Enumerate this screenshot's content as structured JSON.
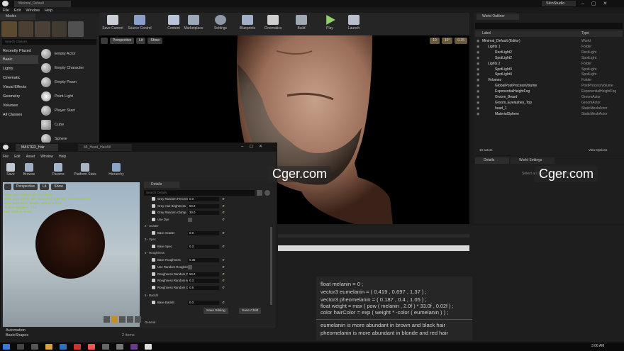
{
  "main_window": {
    "tab": "Minimal_Default",
    "menu": [
      "File",
      "Edit",
      "Window",
      "Help"
    ],
    "app_badge": "SkinStudio"
  },
  "toolbar": [
    "Save Current",
    "Source Control",
    "Content",
    "Marketplace",
    "Settings",
    "Blueprints",
    "Cinematics",
    "Build",
    "Play",
    "Launch"
  ],
  "modes": {
    "tab": "Modes",
    "search_placeholder": "Search Classes",
    "categories": [
      "Recently Placed",
      "Basic",
      "Lights",
      "Cinematic",
      "Visual Effects",
      "Geometry",
      "Volumes",
      "All Classes"
    ],
    "actors": [
      "Empty Actor",
      "Empty Character",
      "Empty Pawn",
      "Point Light",
      "Player Start",
      "Cube",
      "Sphere"
    ]
  },
  "viewport": {
    "buttons": [
      "Perspective",
      "Lit",
      "Show"
    ],
    "snap_values": [
      "10",
      "10°",
      "0.25"
    ]
  },
  "outliner": {
    "tab": "World Outliner",
    "col_label": "Label",
    "col_type": "Type",
    "rows": [
      {
        "name": "Minimal_Default (Editor)",
        "type": "World"
      },
      {
        "name": "Lights 1",
        "type": "Folder"
      },
      {
        "name": "RectLight2",
        "type": "RectLight"
      },
      {
        "name": "SpotLight2",
        "type": "SpotLight"
      },
      {
        "name": "Lights 2",
        "type": "Folder"
      },
      {
        "name": "SpotLight3",
        "type": "SpotLight"
      },
      {
        "name": "SpotLight4",
        "type": "SpotLight"
      },
      {
        "name": "Volumes",
        "type": "Folder"
      },
      {
        "name": "GlobalPostProcessVolume",
        "type": "PostProcessVolume"
      },
      {
        "name": "ExponentialHeightFog",
        "type": "ExponentialHeightFog"
      },
      {
        "name": "Groom_Beard",
        "type": "GroomActor"
      },
      {
        "name": "Groom_Eyelashes_Top",
        "type": "GroomActor"
      },
      {
        "name": "head_1",
        "type": "StaticMeshActor"
      },
      {
        "name": "MaterialSphere",
        "type": "StaticMeshActor"
      }
    ],
    "footer_count": "10 actors",
    "view_options": "View Options"
  },
  "right_tabs": [
    "Details",
    "World Settings"
  ],
  "right_hint": "Select an object to view details.",
  "material_window": {
    "tab1": "MASTER_Hair",
    "tab2": "MI_Head_HairAll",
    "menu": [
      "File",
      "Edit",
      "Asset",
      "Window",
      "Help"
    ],
    "toolbar": [
      "Save",
      "Browse",
      "Params",
      "Platform Stats",
      "Hierarchy"
    ],
    "view_buttons": [
      "Perspective",
      "Lit",
      "Show"
    ],
    "warnings": [
      "Base pass shader: 99 instructions",
      "Base pass shader with Volumetric Lightmap: 101 instructions",
      "Base pass vertex shader: 48 instructions",
      "Texture samplers: 3/16",
      "Hair shaders Model"
    ],
    "details_tab": "Details",
    "details_search": "Search Details",
    "props": [
      {
        "label": "Grey Random Percent",
        "value": "0.0",
        "checked": true
      },
      {
        "label": "Grey Hair Brightness",
        "value": "50.0",
        "checked": true
      },
      {
        "label": "Grey Random Clamp",
        "value": "30.0",
        "checked": true
      },
      {
        "label": "Use Dye",
        "value": "",
        "checked": true
      }
    ],
    "sections": [
      "2 - Scatter",
      "3 - Spec",
      "4 - Roughness",
      "5 - Backlit",
      "General"
    ],
    "scatter": [
      {
        "label": "Base Scatter",
        "value": "0.0"
      }
    ],
    "spec": [
      {
        "label": "Base Spec",
        "value": "0.3"
      }
    ],
    "rough": [
      {
        "label": "Base Roughness",
        "value": "0.35"
      },
      {
        "label": "Use Random Roughness",
        "value": ""
      },
      {
        "label": "Roughness Random Percent",
        "value": "50.0"
      },
      {
        "label": "Roughness Random Min",
        "value": "0.3"
      },
      {
        "label": "Roughness Random Clamp",
        "value": "0.5"
      }
    ],
    "backlit": [
      {
        "label": "Base Backlit",
        "value": "0.0"
      }
    ],
    "save_sibling": "Save Sibling",
    "save_child": "Save Child"
  },
  "code_lines": [
    "float melanin = 0 ;",
    "vector3 eumelanin = ( 0.419 , 0.697 , 1.37 ) ;",
    "vector3 pheomelanin = ( 0.187 , 0.4 , 1.05 ) ;",
    "float weight = max ( pow ( melanin , 2.0f ) * 33.0f , 0.02f ) ;",
    "color hairColor = exp ( weight * -color ( eumelanin ) ) ;"
  ],
  "notes": [
    "eumelanin is more abundant in brown and black hair",
    "pheomelanin is more abundant in blonde and red hair"
  ],
  "content_browser": {
    "folders": [
      "Automation",
      "BasicShapes"
    ],
    "items": "2 items"
  },
  "watermark": "Cger.com",
  "clock": "3:06 AM"
}
